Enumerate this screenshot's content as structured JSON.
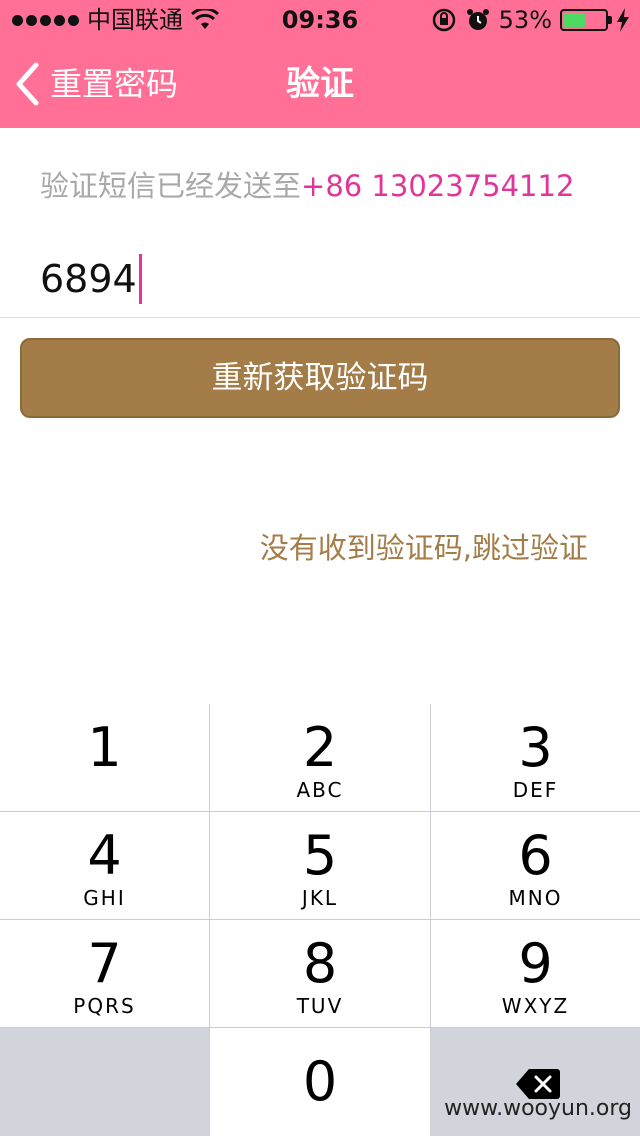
{
  "status_bar": {
    "carrier": "中国联通",
    "time": "09:36",
    "battery_percent": "53%",
    "battery_level": 0.53,
    "icons": [
      "signal-dots-icon",
      "wifi-icon",
      "rotation-lock-icon",
      "alarm-icon",
      "battery-icon",
      "charging-bolt-icon"
    ]
  },
  "nav": {
    "back_label": "重置密码",
    "title": "验证"
  },
  "content": {
    "sent_label": "验证短信已经发送至",
    "phone_number": "+86 13023754112",
    "code_value": "6894",
    "resend_button": "重新获取验证码",
    "skip_link": "没有收到验证码,跳过验证"
  },
  "keypad": {
    "keys": [
      {
        "digit": "1",
        "letters": ""
      },
      {
        "digit": "2",
        "letters": "ABC"
      },
      {
        "digit": "3",
        "letters": "DEF"
      },
      {
        "digit": "4",
        "letters": "GHI"
      },
      {
        "digit": "5",
        "letters": "JKL"
      },
      {
        "digit": "6",
        "letters": "MNO"
      },
      {
        "digit": "7",
        "letters": "PQRS"
      },
      {
        "digit": "8",
        "letters": "TUV"
      },
      {
        "digit": "9",
        "letters": "WXYZ"
      }
    ],
    "zero": "0",
    "delete_icon": "backspace-icon"
  },
  "colors": {
    "header": "#ff6f96",
    "accent_pink": "#e0369a",
    "button_brown": "#a37c47",
    "battery_green": "#4cd964"
  },
  "watermark": "www.wooyun.org"
}
